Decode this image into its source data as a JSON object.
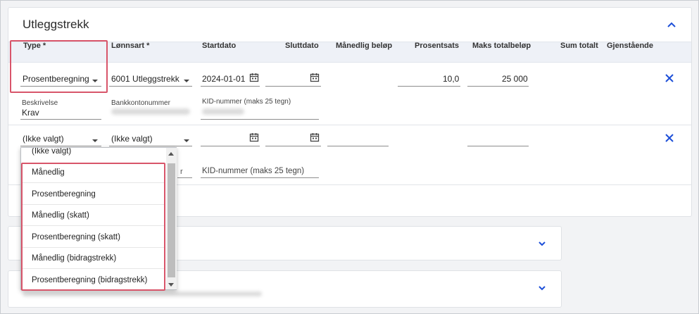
{
  "panel": {
    "title": "Utleggstrekk"
  },
  "columns": [
    "Type *",
    "Lønnsart *",
    "Startdato",
    "Sluttdato",
    "Månedlig beløp",
    "Prosentsats",
    "Maks totalbeløp",
    "Sum totalt",
    "Gjenstående"
  ],
  "row1": {
    "type": "Prosentberegning",
    "lonnsart": "6001 Utleggstrekk",
    "startdato": "2024-01-01",
    "sluttdato": "",
    "prosentsats": "10,0",
    "maks_totalbelop": "25 000",
    "beskrivelse_label": "Beskrivelse",
    "beskrivelse_value": "Krav",
    "bankkonto_label": "Bankkontonummer",
    "kid_label": "KID-nummer (maks 25 tegn)"
  },
  "row2": {
    "type": "(Ikke valgt)",
    "lonnsart": "(Ikke valgt)",
    "kid_placeholder": "KID-nummer (maks 25 tegn)",
    "partial_char": "r"
  },
  "dropdown": {
    "first_partial": "(Ikke valgt)",
    "options": [
      "Månedlig",
      "Prosentberegning",
      "Månedlig (skatt)",
      "Prosentberegning (skatt)",
      "Månedlig (bidragstrekk)",
      "Prosentberegning (bidragstrekk)"
    ]
  },
  "icons": {
    "collapse": "chevron-up-icon",
    "expand": "chevron-down-icon",
    "delete": "close-icon",
    "calendar": "calendar-icon"
  },
  "colors": {
    "accent": "#1d4fd8",
    "highlight": "#d8556a"
  }
}
